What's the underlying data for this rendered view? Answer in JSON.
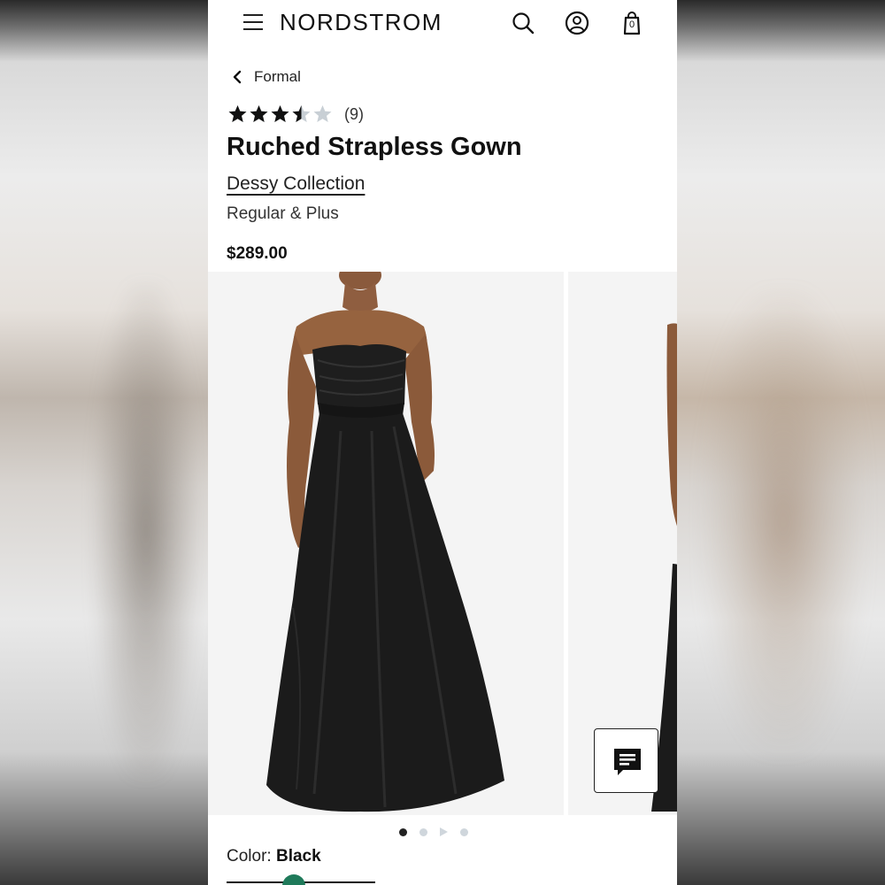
{
  "header": {
    "logo": "NORDSTROM",
    "bag_count": "0"
  },
  "breadcrumb": {
    "label": "Formal"
  },
  "product": {
    "rating": 3.5,
    "max_rating": 5,
    "review_count": "(9)",
    "title": "Ruched Strapless Gown",
    "brand": "Dessy Collection",
    "sizes": "Regular & Plus",
    "price": "$289.00"
  },
  "gallery": {
    "slide_count": 4,
    "active_index": 0
  },
  "color": {
    "label": "Color:",
    "value": "Black"
  },
  "colors": {
    "star_filled": "#111111",
    "star_empty": "#c8cfd5",
    "dot_inactive": "#cfd6dc",
    "swatch_green": "#1f7a5a"
  }
}
